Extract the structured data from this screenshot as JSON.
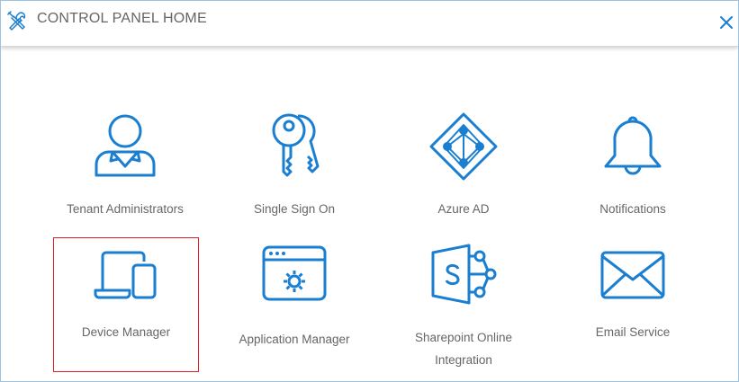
{
  "header": {
    "title": "CONTROL PANEL HOME",
    "icon": "tools-icon",
    "close_icon": "close-icon"
  },
  "colors": {
    "accent": "#1a7fd1",
    "selection": "#e02020"
  },
  "tiles": [
    {
      "label": "Tenant Administrators",
      "icon": "user-admin-icon"
    },
    {
      "label": "Single Sign On",
      "icon": "keys-icon"
    },
    {
      "label": "Azure AD",
      "icon": "azure-ad-icon"
    },
    {
      "label": "Notifications",
      "icon": "bell-icon"
    },
    {
      "label": "Device Manager",
      "icon": "devices-icon",
      "selected": true
    },
    {
      "label": "Application Manager",
      "icon": "app-window-gear-icon"
    },
    {
      "label": "Sharepoint Online Integration",
      "label_lines": [
        "Sharepoint Online",
        "Integration"
      ],
      "icon": "sharepoint-icon"
    },
    {
      "label": "Email Service",
      "icon": "envelope-icon"
    }
  ]
}
